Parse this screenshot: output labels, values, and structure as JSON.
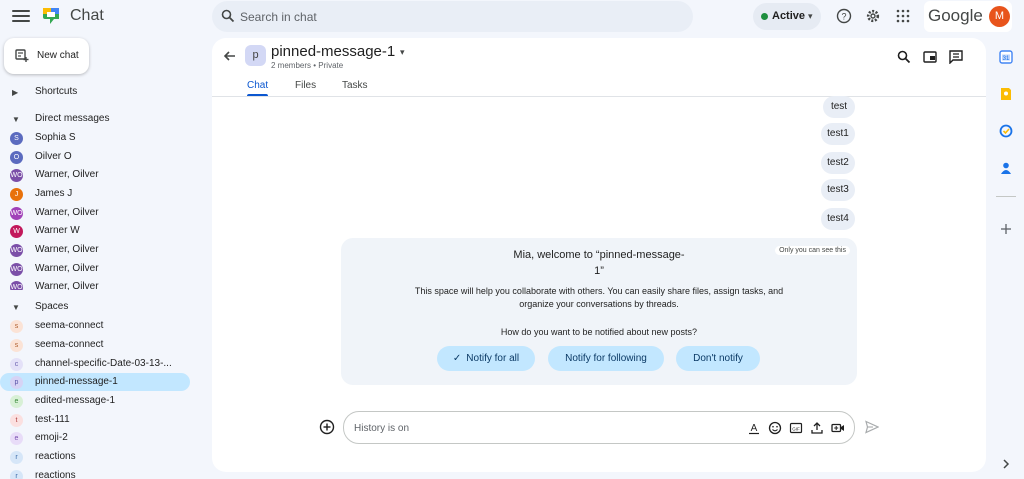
{
  "header": {
    "app_title": "Chat",
    "search_placeholder": "Search in chat",
    "status": "Active",
    "google_word": "Google",
    "account_initial": "M"
  },
  "sidebar": {
    "new_chat_label": "New chat",
    "shortcuts_label": "Shortcuts",
    "direct_messages_label": "Direct messages",
    "direct_messages": [
      {
        "name": "Sophia S",
        "initial": "S",
        "color": "#5b6bbf"
      },
      {
        "name": "Oilver O",
        "initial": "O",
        "color": "#5b6bbf"
      },
      {
        "name": "Warner, Oilver",
        "initial": "WO",
        "color": "#7b4fa8"
      },
      {
        "name": "James J",
        "initial": "J",
        "color": "#e8710a"
      },
      {
        "name": "Warner, Oilver",
        "initial": "WO",
        "color": "#a142b8"
      },
      {
        "name": "Warner W",
        "initial": "W",
        "color": "#c2185b"
      },
      {
        "name": "Warner, Oilver",
        "initial": "WO",
        "color": "#7b4fa8"
      },
      {
        "name": "Warner, Oilver",
        "initial": "WO",
        "color": "#7b4fa8"
      },
      {
        "name": "Warner, Oilver",
        "initial": "WO",
        "color": "#7b4fa8"
      }
    ],
    "spaces_label": "Spaces",
    "spaces": [
      {
        "name": "seema-connect",
        "initial": "s",
        "color": "#fbe3d6"
      },
      {
        "name": "seema-connect",
        "initial": "s",
        "color": "#fbe3d6"
      },
      {
        "name": "channel-specific-Date-03-13-...",
        "initial": "c",
        "color": "#e4e1f8"
      },
      {
        "name": "pinned-message-1",
        "initial": "p",
        "color": "#d6d3f5"
      },
      {
        "name": "edited-message-1",
        "initial": "e",
        "color": "#d8f0d6"
      },
      {
        "name": "test-111",
        "initial": "t",
        "color": "#fbe0e0"
      },
      {
        "name": "emoji-2",
        "initial": "e",
        "color": "#e8dcf8"
      },
      {
        "name": "reactions",
        "initial": "r",
        "color": "#d6e6f8"
      },
      {
        "name": "reactions",
        "initial": "r",
        "color": "#d6e6f8"
      }
    ]
  },
  "space": {
    "avatar": "p",
    "title": "pinned-message-1",
    "members": "2 members",
    "separator": "•",
    "privacy": "Private",
    "tabs": [
      "Chat",
      "Files",
      "Tasks"
    ]
  },
  "messages": [
    "test",
    "test1",
    "test2",
    "test3",
    "test4"
  ],
  "welcome": {
    "badge": "Only you can see this",
    "title_line1": "Mia, welcome to “pinned-message-",
    "title_line2": "1”",
    "body_line1": "This space will help you collaborate with others. You can easily share files, assign tasks, and",
    "body_line2": "organize your conversations by threads.",
    "question": "How do you want to be notified about new posts?",
    "buttons": [
      "Notify for all",
      "Notify for following",
      "Don't notify"
    ]
  },
  "compose": {
    "placeholder": "History is on"
  }
}
